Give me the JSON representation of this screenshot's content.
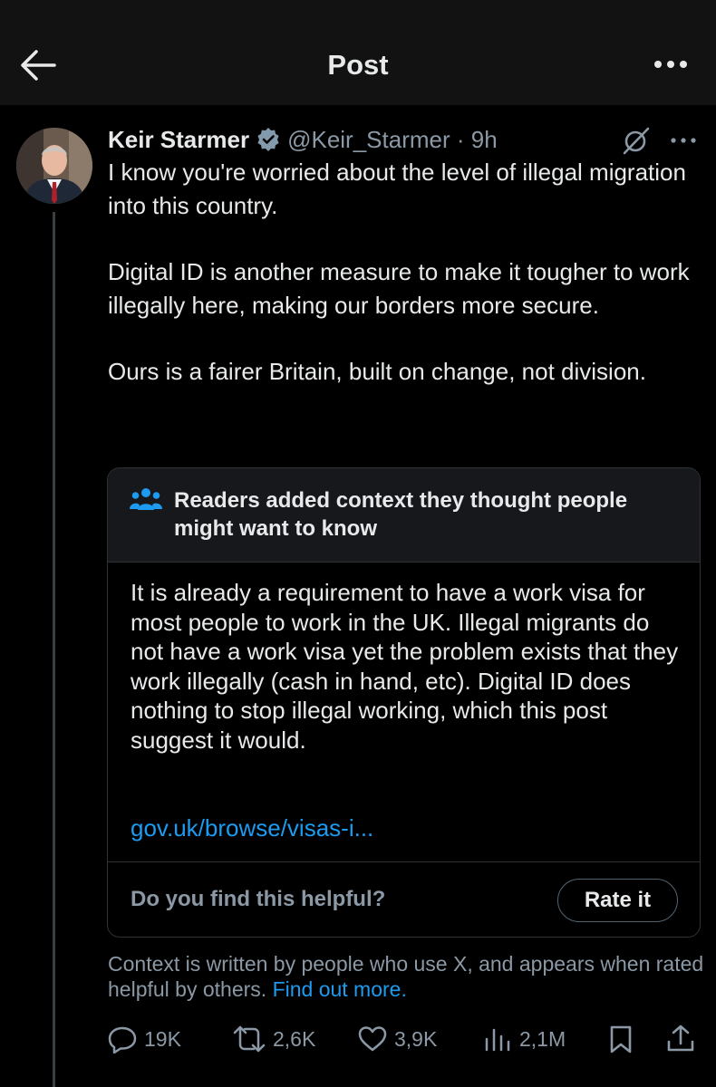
{
  "header": {
    "title": "Post",
    "back_icon": "arrow-left-icon",
    "more_icon": "more-horizontal-icon"
  },
  "post": {
    "author_name": "Keir Starmer",
    "handle_time": "@Keir_Starmer · 9h",
    "verified_color": "#829aab",
    "paragraphs": [
      "I know you're worried about the level of illegal migration into this country.",
      "Digital ID is another measure to make it tougher to work illegally here, making our borders more secure.",
      "Ours is a fairer Britain, built on change, not division."
    ]
  },
  "community_note": {
    "title": "Readers added context they thought people might want to know",
    "body": "It is already a requirement to have a work visa for most people to work in the UK.  Illegal migrants do not have a work visa yet the problem exists that they work illegally (cash in hand, etc).  Digital ID does nothing to stop illegal working, which this post suggest it would.",
    "link": "gov.uk/browse/visas-i...",
    "helpful_question": "Do you find this helpful?",
    "rate_label": "Rate it",
    "footer_text": "Context is written by people who use X, and appears when rated helpful by others.",
    "find_out_more": "Find out more."
  },
  "actions": {
    "replies": "19K",
    "reposts": "2,6K",
    "likes": "3,9K",
    "views": "2,1M"
  },
  "colors": {
    "background": "#000000",
    "header_bg": "#121212",
    "text": "#e7e9ea",
    "muted": "#8b98a5",
    "link": "#1d9bf0"
  }
}
